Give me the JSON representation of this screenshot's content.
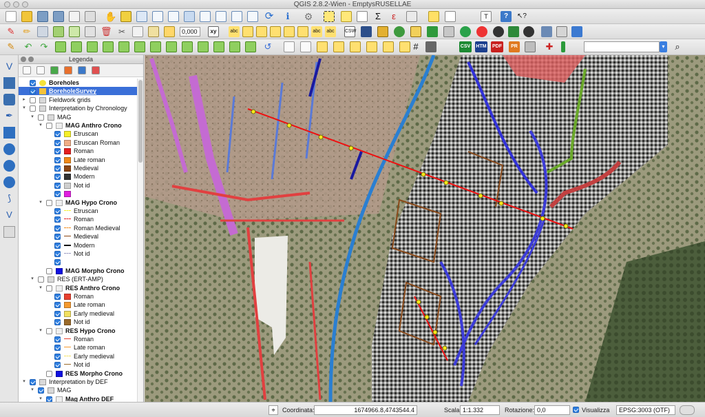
{
  "window": {
    "title": "QGIS 2.8.2-Wien - EmptysRUSELLAE"
  },
  "toolbar": {
    "zoom_value": "0,000",
    "search_placeholder": ""
  },
  "toolbar_text_icons": {
    "csv": "CSV",
    "htm": "HTM",
    "pdf": "PDF",
    "pr": "PR",
    "abc": "abc",
    "xy": "xy"
  },
  "legend": {
    "title": "Legenda",
    "items": [
      {
        "label": "Boreholes",
        "bold": true
      },
      {
        "label": "BoreholeSurvey",
        "bold": true
      },
      {
        "label": "Fieldwork grids"
      },
      {
        "label": "Interpretation by Chronology"
      },
      {
        "label": "MAG"
      },
      {
        "label": "MAG Anthro Crono",
        "bold": true
      },
      {
        "label": "Etruscan"
      },
      {
        "label": "Etruscan Roman"
      },
      {
        "label": "Roman"
      },
      {
        "label": "Late roman"
      },
      {
        "label": "Medieval"
      },
      {
        "label": "Modern"
      },
      {
        "label": "Not id"
      },
      {
        "label": ""
      },
      {
        "label": "MAG Hypo Crono",
        "bold": true
      },
      {
        "label": "Etruscan"
      },
      {
        "label": "Roman"
      },
      {
        "label": "Roman Medieval"
      },
      {
        "label": "Medieval"
      },
      {
        "label": "Modern"
      },
      {
        "label": "Not id"
      },
      {
        "label": ""
      },
      {
        "label": "MAG Morpho Crono",
        "bold": true
      },
      {
        "label": "RES (ERT-AMP)"
      },
      {
        "label": "RES Anthro Crono",
        "bold": true
      },
      {
        "label": "Roman"
      },
      {
        "label": "Late roman"
      },
      {
        "label": "Early medieval"
      },
      {
        "label": "Not id"
      },
      {
        "label": "RES Hypo Crono",
        "bold": true
      },
      {
        "label": "Roman"
      },
      {
        "label": "Late roman"
      },
      {
        "label": "Early medieval"
      },
      {
        "label": "Not id"
      },
      {
        "label": "RES Morpho Crono",
        "bold": true
      },
      {
        "label": "Interpretation by DEF"
      },
      {
        "label": "MAG"
      },
      {
        "label": "Mag Anthro DEF",
        "bold": true
      }
    ]
  },
  "colors": {
    "etruscan": "#f5ef2a",
    "etruscan_roman": "#f0ad86",
    "roman": "#e52020",
    "late_roman": "#f08a1a",
    "medieval": "#8b4513",
    "modern": "#333333",
    "not_id": "#cfcfcf",
    "magenta": "#e020e0",
    "blue": "#1010e0",
    "res_roman": "#e84030",
    "res_late_roman": "#f49a30",
    "res_early_medieval": "#f2e060",
    "res_not_id": "#9a6a2a"
  },
  "statusbar": {
    "coord_label": "Coordinata:",
    "coord_value": "1674966.8,4743544.4",
    "scale_label": "Scala",
    "scale_value": "1:1.332",
    "rotation_label": "Rotazione:",
    "rotation_value": "0,0",
    "render_label": "Visualizza",
    "crs_label": "EPSG:3003 (OTF)"
  }
}
